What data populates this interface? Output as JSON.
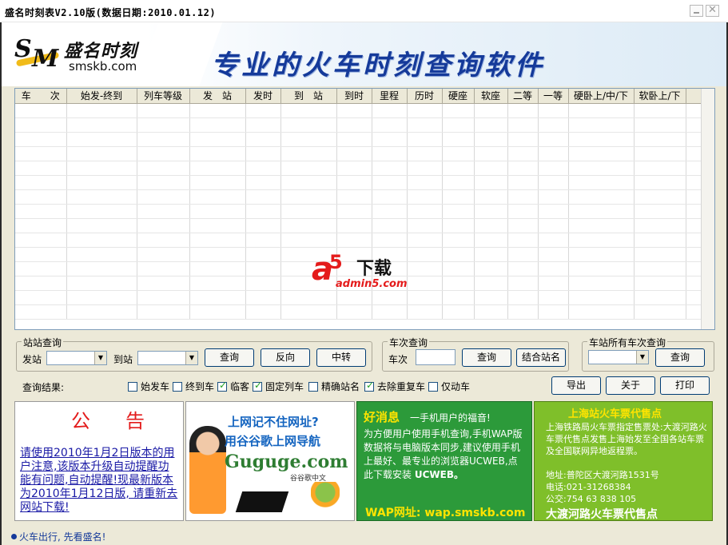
{
  "window": {
    "title": "盛名时刻表V2.10版(数据日期:2010.01.12)"
  },
  "banner": {
    "logo_name": "盛名时刻",
    "logo_url": "smskb.com",
    "slogan": "专业的火车时刻查询软件"
  },
  "grid": {
    "columns": [
      "车　　次",
      "始发-终到",
      "列车等级",
      "发　站",
      "发时",
      "到　站",
      "到时",
      "里程",
      "历时",
      "硬座",
      "软座",
      "二等",
      "一等",
      "硬卧上/中/下",
      "软卧上/下"
    ],
    "rows": []
  },
  "watermark": {
    "a": "a",
    "five": "5",
    "text": "下载",
    "domain": "admin5.com"
  },
  "station_query": {
    "legend": "站站查询",
    "from_label": "发站",
    "to_label": "到站",
    "from_value": "",
    "to_value": "",
    "query_button": "查询",
    "reverse_button": "反向",
    "transfer_button": "中转"
  },
  "train_query": {
    "legend": "车次查询",
    "train_label": "车次",
    "train_value": "",
    "query_button": "查询",
    "combine_button": "结合站名"
  },
  "station_all_query": {
    "legend": "车站所有车次查询",
    "station_value": "",
    "query_button": "查询"
  },
  "results": {
    "label": "查询结果:",
    "filters": [
      {
        "label": "始发车",
        "checked": false
      },
      {
        "label": "终到车",
        "checked": false
      },
      {
        "label": "临客",
        "checked": true
      },
      {
        "label": "固定列车",
        "checked": true
      },
      {
        "label": "精确站名",
        "checked": false
      },
      {
        "label": "去除重复车",
        "checked": true
      },
      {
        "label": "仅动车",
        "checked": false
      }
    ],
    "export_button": "导出",
    "about_button": "关于",
    "print_button": "打印"
  },
  "ads": {
    "notice_title": "公　告",
    "notice_body": "请使用2010年1月2日版本的用户注意,该版本升级自动提醒功能有问题,自动提醒!现最新版本为2010年1月12日版, 请重新去网站下载!",
    "guguge_line1": "上网记不住网址?",
    "guguge_line2": "用谷谷歌上网导航",
    "guguge_brand": "Guguge.com",
    "guguge_sub": "谷谷歌中文",
    "wap_title": "好消息",
    "wap_title_rest": "一手机用户的福音!",
    "wap_body": "为方便用户使用手机查询,手机WAP版数据将与电脑版本同步,建议使用手机上最好、最专业的浏览器UCWEB,点此下载安装",
    "wap_brand": "UCWEB。",
    "wap_footer": "WAP网址: wap.smskb.com",
    "agent_title": "上海站火车票代售点",
    "agent_body": "上海铁路局火车票指定售票处:大渡河路火车票代售点发售上海始发至全国各站车票及全国联网异地返程票。",
    "agent_addr": "地址:普陀区大渡河路1531号",
    "agent_tel": "电话:021-31268384",
    "agent_bus": "公交:754 63 838 105",
    "agent_footer": "大渡河路火车票代售点"
  },
  "statusbar": {
    "text": "火车出行, 先看盛名!"
  }
}
